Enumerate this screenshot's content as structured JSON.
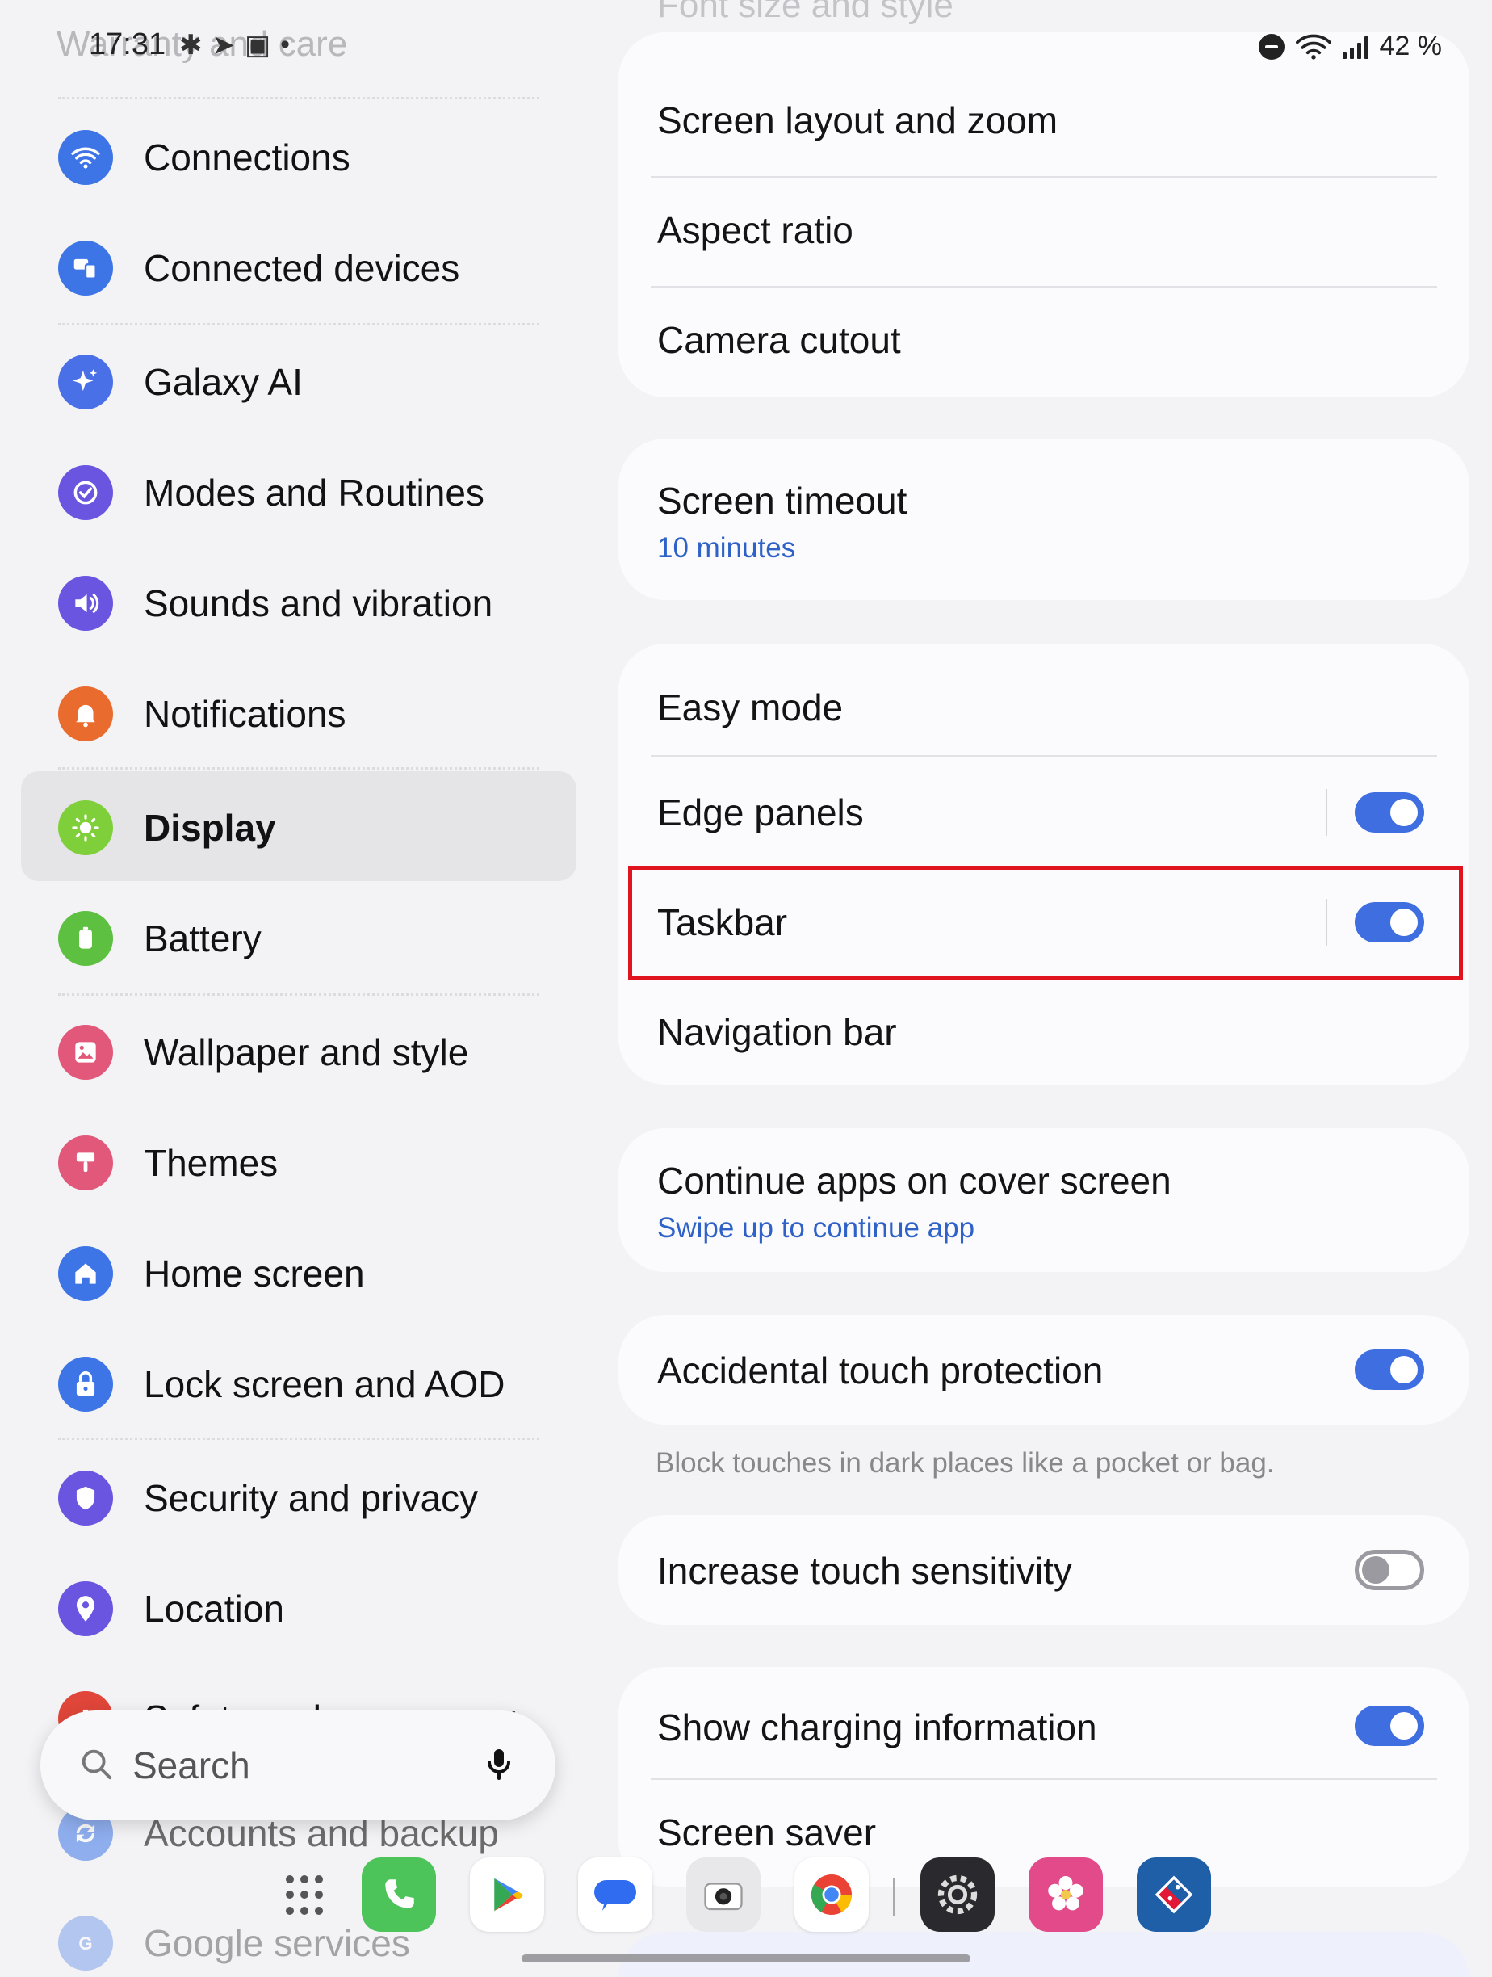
{
  "status_bar": {
    "time": "17:31",
    "battery_percent": "42 %"
  },
  "nav": {
    "ghost_top_label": "Warranty and care",
    "items": [
      {
        "label": "Connections",
        "icon": "wifi-icon",
        "color": "#3d74e6"
      },
      {
        "label": "Connected devices",
        "icon": "connected-devices-icon",
        "color": "#3d74e6"
      },
      {
        "label": "Galaxy AI",
        "icon": "sparkle-icon",
        "color": "#4a70e8"
      },
      {
        "label": "Modes and Routines",
        "icon": "check-circle-icon",
        "color": "#6a55e0"
      },
      {
        "label": "Sounds and vibration",
        "icon": "speaker-icon",
        "color": "#6a55e0"
      },
      {
        "label": "Notifications",
        "icon": "bell-icon",
        "color": "#e96b2e"
      },
      {
        "label": "Display",
        "icon": "sun-icon",
        "color": "#7fcf3a",
        "selected": true
      },
      {
        "label": "Battery",
        "icon": "battery-icon",
        "color": "#5dc041"
      },
      {
        "label": "Wallpaper and style",
        "icon": "image-icon",
        "color": "#e2587a"
      },
      {
        "label": "Themes",
        "icon": "brush-icon",
        "color": "#e2587a"
      },
      {
        "label": "Home screen",
        "icon": "home-icon",
        "color": "#3d74e6"
      },
      {
        "label": "Lock screen and AOD",
        "icon": "lock-icon",
        "color": "#3d74e6"
      },
      {
        "label": "Security and privacy",
        "icon": "shield-icon",
        "color": "#6a55e0"
      },
      {
        "label": "Location",
        "icon": "location-pin-icon",
        "color": "#6a55e0"
      },
      {
        "label": "Safety and emergency",
        "icon": "emergency-icon",
        "color": "#e0463a"
      },
      {
        "label": "Accounts and backup",
        "icon": "sync-icon",
        "color": "#3d74e6"
      },
      {
        "label": "Google services",
        "icon": "google-icon",
        "color": "#3d74e6"
      }
    ]
  },
  "search": {
    "placeholder": "Search"
  },
  "content": {
    "ghost_top_label": "Font size and style",
    "card1": {
      "rows": [
        "Screen layout and zoom",
        "Aspect ratio",
        "Camera cutout"
      ]
    },
    "screen_timeout": {
      "label": "Screen timeout",
      "value": "10 minutes"
    },
    "card3": {
      "easy_mode": "Easy mode",
      "edge_panels": {
        "label": "Edge panels",
        "enabled": true
      },
      "taskbar": {
        "label": "Taskbar",
        "enabled": true
      },
      "navigation_bar": "Navigation bar"
    },
    "continue_apps": {
      "label": "Continue apps on cover screen",
      "value": "Swipe up to continue app"
    },
    "accidental_touch": {
      "label": "Accidental touch protection",
      "enabled": true,
      "helper": "Block touches in dark places like a pocket or bag."
    },
    "touch_sensitivity": {
      "label": "Increase touch sensitivity",
      "enabled": false
    },
    "card7": {
      "charging_info": {
        "label": "Show charging information",
        "enabled": true
      },
      "screen_saver": "Screen saver"
    }
  },
  "dock": {
    "apps": [
      {
        "name": "phone-app-icon",
        "color": "#4cc45a"
      },
      {
        "name": "play-store-app-icon",
        "color": "#ffffff"
      },
      {
        "name": "messages-app-icon",
        "color": "#ffffff"
      },
      {
        "name": "camera-app-icon",
        "color": "#e8e8ea"
      },
      {
        "name": "chrome-app-icon",
        "color": "#ffffff"
      },
      {
        "name": "settings-app-icon",
        "color": "#2a2a2e"
      },
      {
        "name": "gallery-app-icon",
        "color": "#e24a8a"
      },
      {
        "name": "dominos-app-icon",
        "color": "#1f5fa8"
      }
    ]
  },
  "colors": {
    "accent": "#3e6ee0",
    "highlight": "#e0141e",
    "background": "#f3f3f6",
    "card": "#fbfbfd"
  }
}
